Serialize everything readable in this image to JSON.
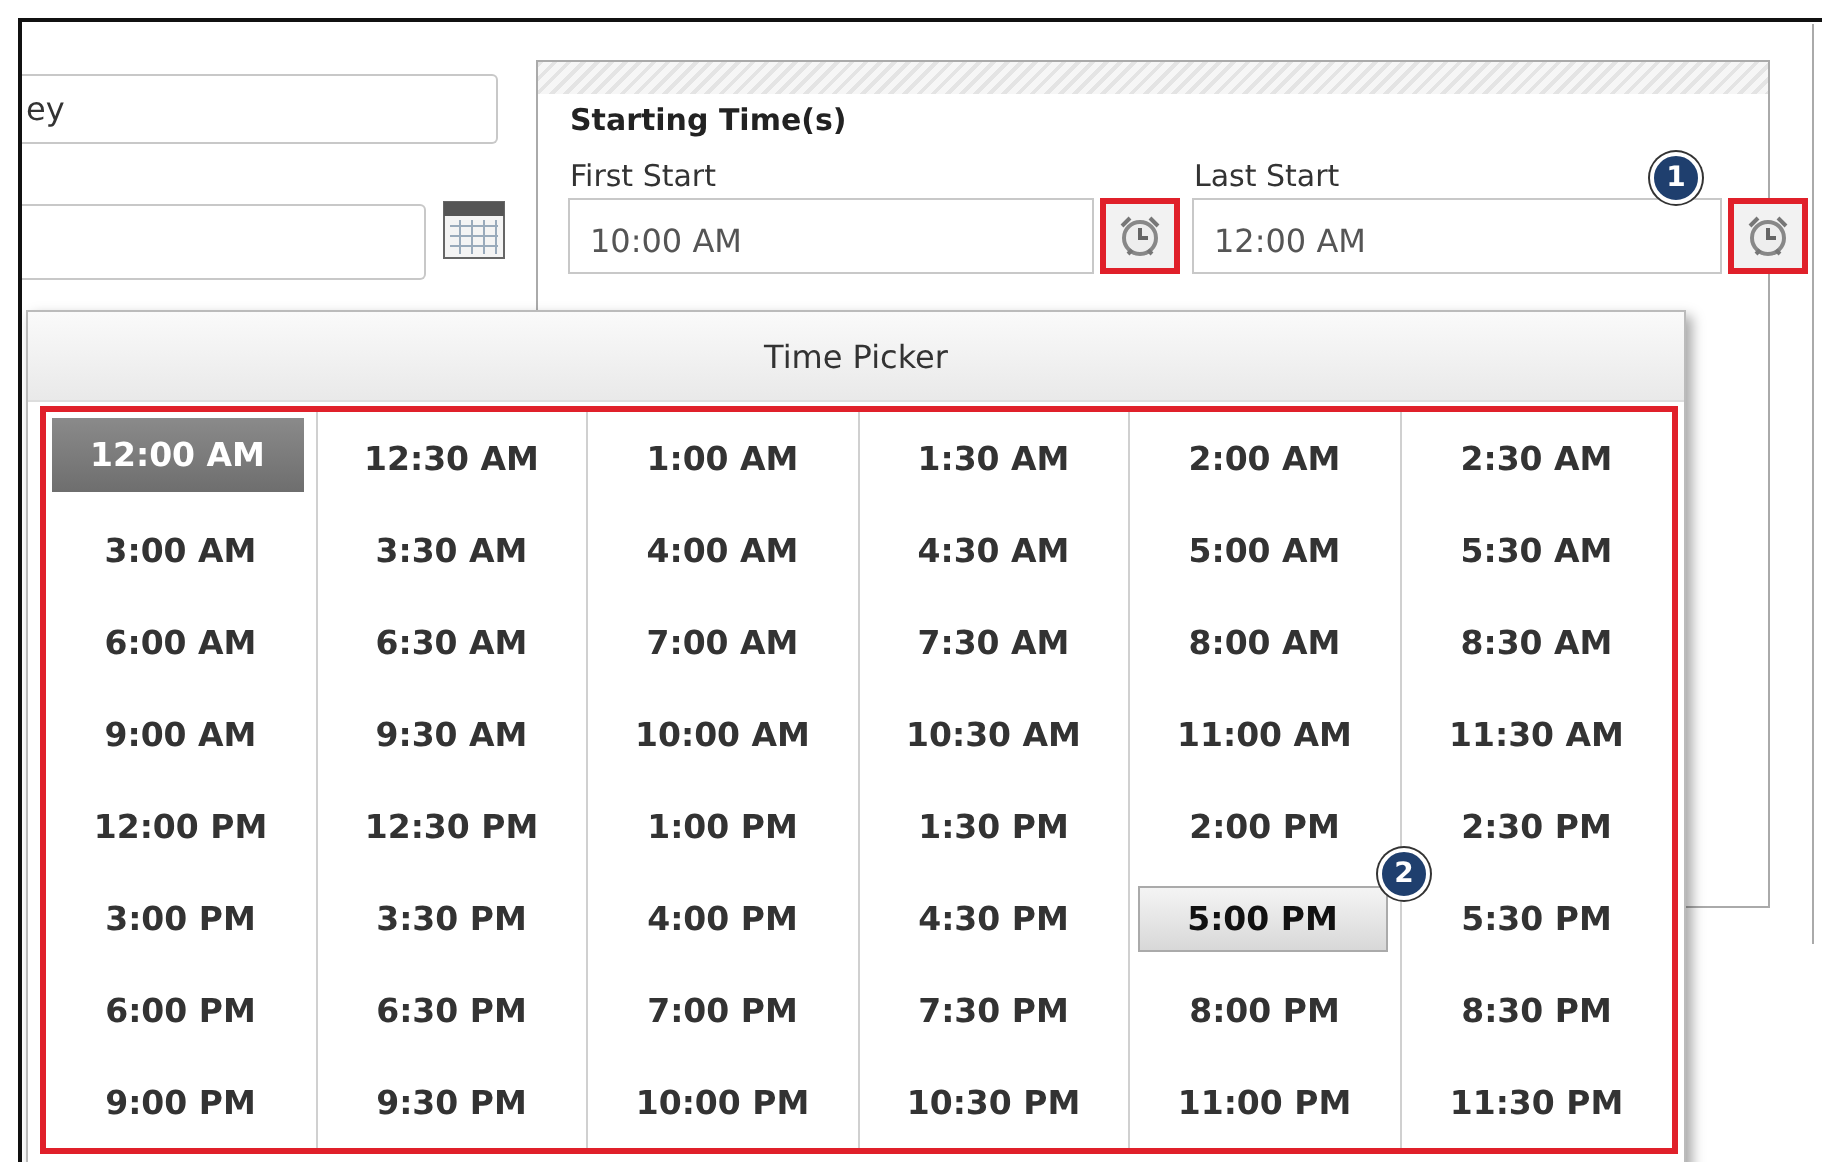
{
  "left_form": {
    "name_field": {
      "value": "ey"
    }
  },
  "starting_times": {
    "title": "Starting Time(s)",
    "first_start": {
      "label": "First Start",
      "value": "10:00 AM",
      "clock_highlighted": true
    },
    "last_start": {
      "label": "Last Start",
      "value": "12:00 AM",
      "clock_highlighted": true
    }
  },
  "time_picker": {
    "title": "Time Picker",
    "highlighted": true,
    "times": [
      {
        "label": "12:00 AM",
        "selected": true,
        "hovered": false
      },
      {
        "label": "12:30 AM",
        "selected": false,
        "hovered": false
      },
      {
        "label": "1:00 AM",
        "selected": false,
        "hovered": false
      },
      {
        "label": "1:30 AM",
        "selected": false,
        "hovered": false
      },
      {
        "label": "2:00 AM",
        "selected": false,
        "hovered": false
      },
      {
        "label": "2:30 AM",
        "selected": false,
        "hovered": false
      },
      {
        "label": "3:00 AM",
        "selected": false,
        "hovered": false
      },
      {
        "label": "3:30 AM",
        "selected": false,
        "hovered": false
      },
      {
        "label": "4:00 AM",
        "selected": false,
        "hovered": false
      },
      {
        "label": "4:30 AM",
        "selected": false,
        "hovered": false
      },
      {
        "label": "5:00 AM",
        "selected": false,
        "hovered": false
      },
      {
        "label": "5:30 AM",
        "selected": false,
        "hovered": false
      },
      {
        "label": "6:00 AM",
        "selected": false,
        "hovered": false
      },
      {
        "label": "6:30 AM",
        "selected": false,
        "hovered": false
      },
      {
        "label": "7:00 AM",
        "selected": false,
        "hovered": false
      },
      {
        "label": "7:30 AM",
        "selected": false,
        "hovered": false
      },
      {
        "label": "8:00 AM",
        "selected": false,
        "hovered": false
      },
      {
        "label": "8:30 AM",
        "selected": false,
        "hovered": false
      },
      {
        "label": "9:00 AM",
        "selected": false,
        "hovered": false
      },
      {
        "label": "9:30 AM",
        "selected": false,
        "hovered": false
      },
      {
        "label": "10:00 AM",
        "selected": false,
        "hovered": false
      },
      {
        "label": "10:30 AM",
        "selected": false,
        "hovered": false
      },
      {
        "label": "11:00 AM",
        "selected": false,
        "hovered": false
      },
      {
        "label": "11:30 AM",
        "selected": false,
        "hovered": false
      },
      {
        "label": "12:00 PM",
        "selected": false,
        "hovered": false
      },
      {
        "label": "12:30 PM",
        "selected": false,
        "hovered": false
      },
      {
        "label": "1:00 PM",
        "selected": false,
        "hovered": false
      },
      {
        "label": "1:30 PM",
        "selected": false,
        "hovered": false
      },
      {
        "label": "2:00 PM",
        "selected": false,
        "hovered": false
      },
      {
        "label": "2:30 PM",
        "selected": false,
        "hovered": false
      },
      {
        "label": "3:00 PM",
        "selected": false,
        "hovered": false
      },
      {
        "label": "3:30 PM",
        "selected": false,
        "hovered": false
      },
      {
        "label": "4:00 PM",
        "selected": false,
        "hovered": false
      },
      {
        "label": "4:30 PM",
        "selected": false,
        "hovered": false
      },
      {
        "label": "5:00 PM",
        "selected": false,
        "hovered": true
      },
      {
        "label": "5:30 PM",
        "selected": false,
        "hovered": false
      },
      {
        "label": "6:00 PM",
        "selected": false,
        "hovered": false
      },
      {
        "label": "6:30 PM",
        "selected": false,
        "hovered": false
      },
      {
        "label": "7:00 PM",
        "selected": false,
        "hovered": false
      },
      {
        "label": "7:30 PM",
        "selected": false,
        "hovered": false
      },
      {
        "label": "8:00 PM",
        "selected": false,
        "hovered": false
      },
      {
        "label": "8:30 PM",
        "selected": false,
        "hovered": false
      },
      {
        "label": "9:00 PM",
        "selected": false,
        "hovered": false
      },
      {
        "label": "9:30 PM",
        "selected": false,
        "hovered": false
      },
      {
        "label": "10:00 PM",
        "selected": false,
        "hovered": false
      },
      {
        "label": "10:30 PM",
        "selected": false,
        "hovered": false
      },
      {
        "label": "11:00 PM",
        "selected": false,
        "hovered": false
      },
      {
        "label": "11:30 PM",
        "selected": false,
        "hovered": false
      }
    ]
  },
  "annotations": [
    {
      "number": "1"
    },
    {
      "number": "2"
    }
  ]
}
